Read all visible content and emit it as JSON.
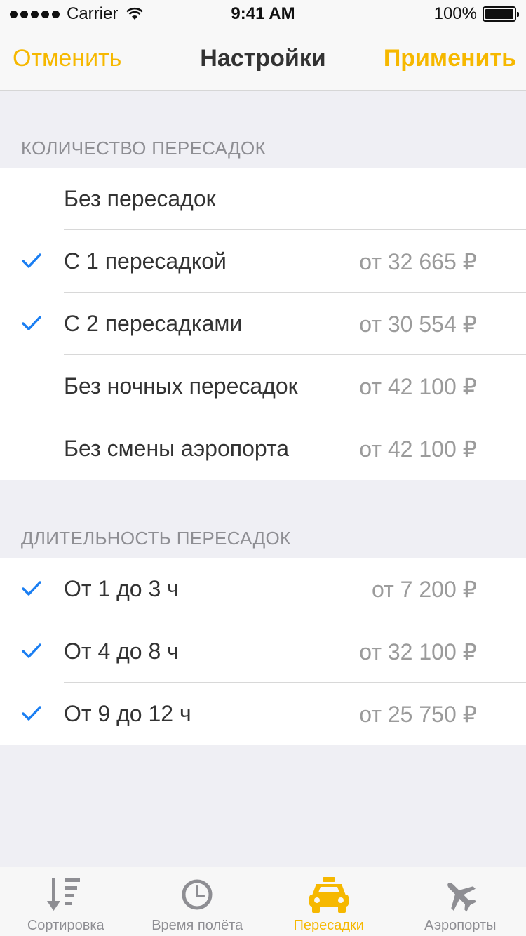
{
  "status_bar": {
    "carrier": "Carrier",
    "time": "9:41 AM",
    "battery": "100%"
  },
  "nav": {
    "cancel_label": "Отменить",
    "title": "Настройки",
    "apply_label": "Применить"
  },
  "sections": [
    {
      "header": "КОЛИЧЕСТВО ПЕРЕСАДОК",
      "rows": [
        {
          "label": "Без пересадок",
          "price": "",
          "checked": false
        },
        {
          "label": "С 1 пересадкой",
          "price": "от 32 665 ₽",
          "checked": true
        },
        {
          "label": "С 2 пересадками",
          "price": "от 30 554 ₽",
          "checked": true
        },
        {
          "label": "Без ночных пересадок",
          "price": "от 42 100 ₽",
          "checked": false
        },
        {
          "label": "Без смены аэропорта",
          "price": "от 42 100 ₽",
          "checked": false
        }
      ]
    },
    {
      "header": "ДЛИТЕЛЬНОСТЬ ПЕРЕСАДОК",
      "rows": [
        {
          "label": "От 1 до 3 ч",
          "price": "от 7 200 ₽",
          "checked": true
        },
        {
          "label": "От 4 до 8 ч",
          "price": "от 32 100 ₽",
          "checked": true
        },
        {
          "label": "От 9 до 12 ч",
          "price": "от 25 750 ₽",
          "checked": true
        }
      ]
    }
  ],
  "tabs": [
    {
      "label": "Сортировка",
      "icon": "sort-icon",
      "active": false
    },
    {
      "label": "Время полёта",
      "icon": "clock-icon",
      "active": false
    },
    {
      "label": "Пересадки",
      "icon": "taxi-icon",
      "active": true
    },
    {
      "label": "Аэропорты",
      "icon": "plane-icon",
      "active": false
    }
  ],
  "colors": {
    "accent": "#f6b800",
    "check": "#1a7ef2",
    "inactive_icon": "#8e8e93"
  }
}
